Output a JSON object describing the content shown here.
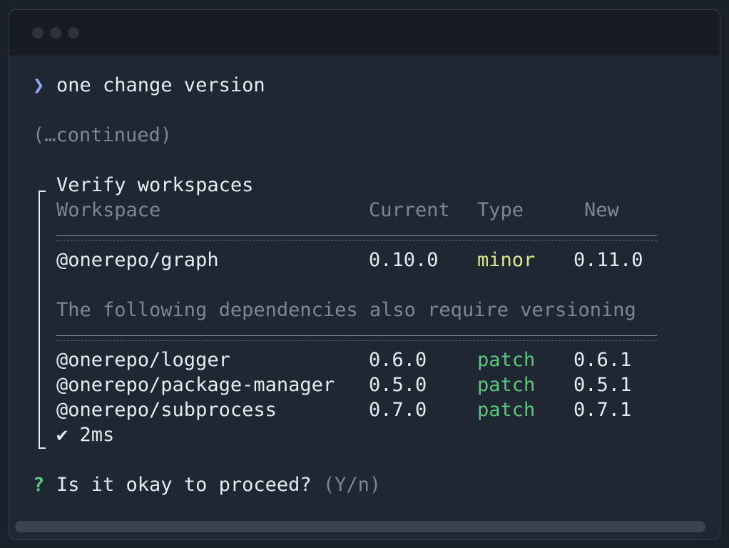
{
  "window": {
    "controls": [
      "close",
      "minimize",
      "maximize"
    ]
  },
  "terminal": {
    "prompt_symbol": "❯",
    "command": "one change version",
    "continued": "(…continued)",
    "section_title": "Verify workspaces",
    "table": {
      "headers": [
        "Workspace",
        "Current",
        "Type",
        "New"
      ],
      "primary_rows": [
        {
          "workspace": "@onerepo/graph",
          "current": "0.10.0",
          "type": "minor",
          "new": "0.11.0"
        }
      ],
      "dependencies_note": "The following dependencies also require versioning",
      "dependency_rows": [
        {
          "workspace": "@onerepo/logger",
          "current": "0.6.0",
          "type": "patch",
          "new": "0.6.1"
        },
        {
          "workspace": "@onerepo/package-manager",
          "current": "0.5.0",
          "type": "patch",
          "new": "0.5.1"
        },
        {
          "workspace": "@onerepo/subprocess",
          "current": "0.7.0",
          "type": "patch",
          "new": "0.7.1"
        }
      ]
    },
    "timing": "✔ 2ms",
    "question": {
      "marker": "?",
      "text": "Is it okay to proceed?",
      "hint": "(Y/n)"
    }
  },
  "colors": {
    "background": "#1f2733",
    "titlebar": "#171c22",
    "prompt": "#8ea9ff",
    "muted": "#7d8794",
    "patch": "#58c97a",
    "minor": "#d8ea8f",
    "text": "#e6ebf1"
  }
}
